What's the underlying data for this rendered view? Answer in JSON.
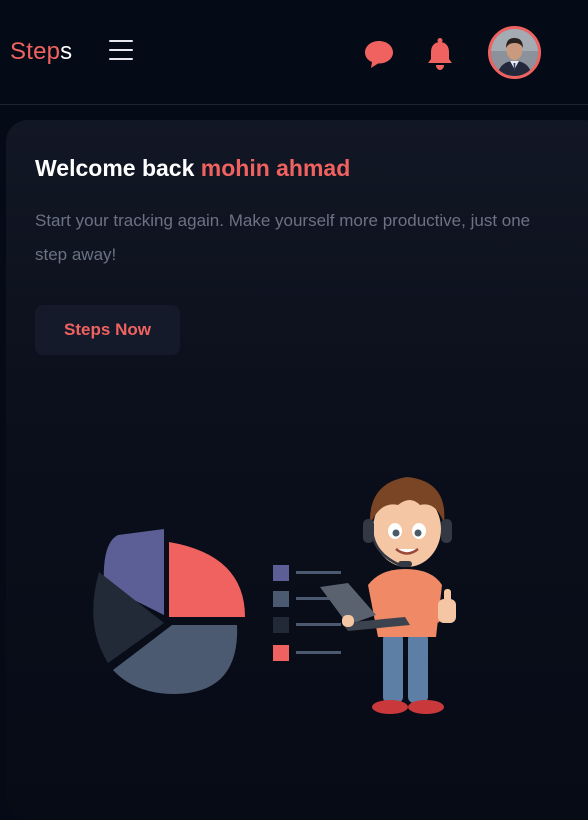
{
  "header": {
    "brand_part1": "Step",
    "brand_part2": "s",
    "menu_icon": "hamburger-menu-icon",
    "chat_icon": "chat-bubble-icon",
    "notification_icon": "bell-icon",
    "avatar_icon": "user-avatar"
  },
  "hero": {
    "welcome_prefix": "Welcome back ",
    "user_name": "mohin ahmad",
    "subtitle": "Start your tracking again. Make yourself more productive, just one step away!",
    "cta_label": "Steps Now"
  },
  "colors": {
    "accent": "#f0625f",
    "background": "#050a17",
    "card": "#121725",
    "muted_text": "#6b7282",
    "pie_purple": "#5c5f96",
    "pie_slate": "#4b5a70",
    "pie_dark": "#222a38"
  }
}
